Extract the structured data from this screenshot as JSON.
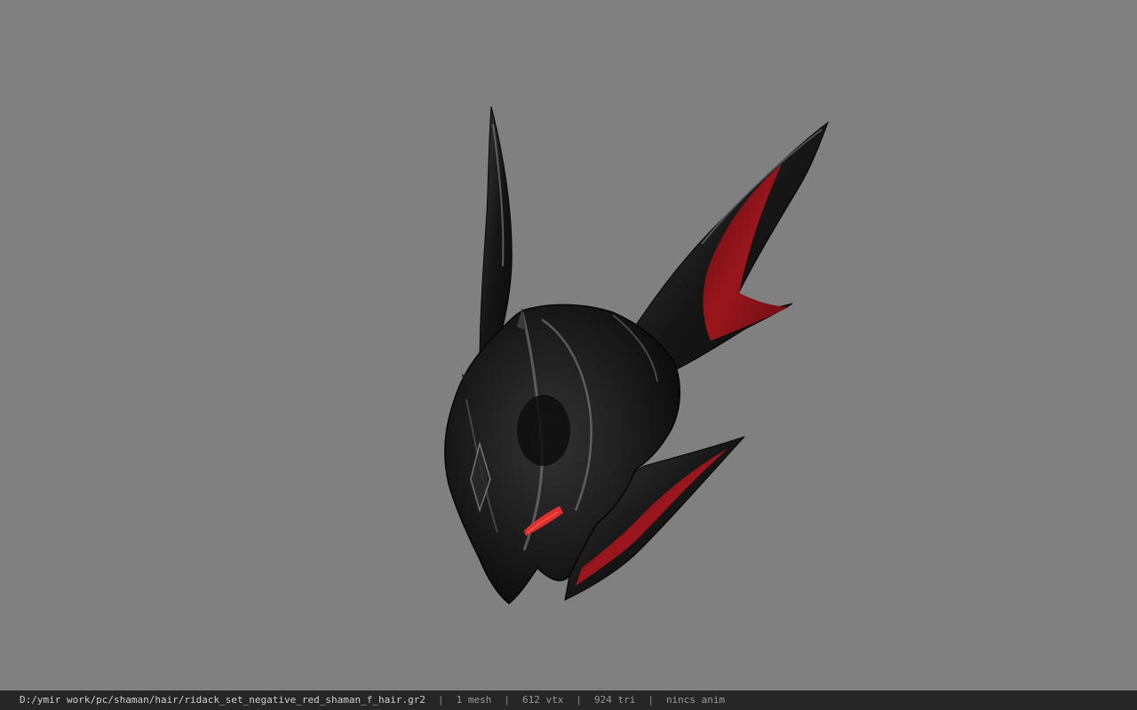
{
  "viewer": {
    "background_color": "#808080",
    "model_colors": {
      "armor_dark": "#141414",
      "armor_mid": "#2a2a2a",
      "highlight": "#6e6e6e",
      "accent_red": "#8a1418",
      "glow_red": "#e0302e"
    }
  },
  "status_bar": {
    "file_path": "D:/ymir work/pc/shaman/hair/ridack_set_negative_red_shaman_f_hair.gr2",
    "separator": "|",
    "mesh_count": "1 mesh",
    "vertex_count": "612 vtx",
    "triangle_count": "924 tri",
    "anim_status": "nincs anim"
  }
}
